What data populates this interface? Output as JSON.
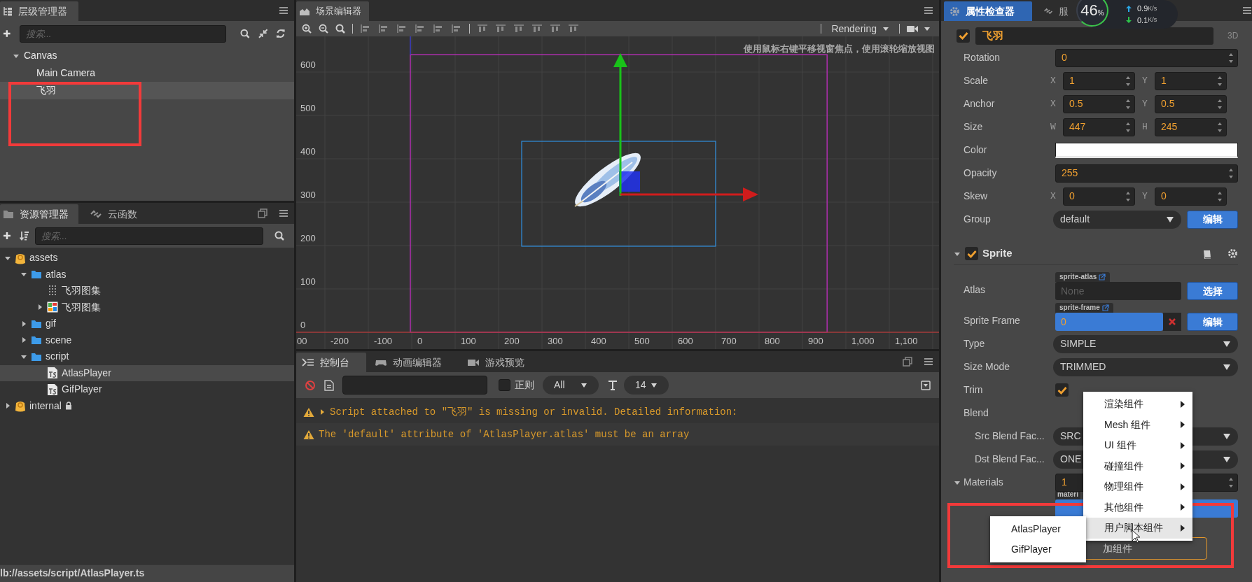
{
  "hierarchy": {
    "title": "层级管理器",
    "search": {
      "placeholder": "搜索..."
    },
    "tree": [
      {
        "label": "Canvas",
        "expanded": true,
        "selected": false,
        "children": [
          {
            "label": "Main Camera",
            "selected": false
          },
          {
            "label": "飞羽",
            "selected": true
          }
        ]
      }
    ]
  },
  "assets": {
    "tabs": [
      {
        "label": "资源管理器",
        "selected": true
      },
      {
        "label": "云函数",
        "selected": false
      }
    ],
    "search": {
      "placeholder": "搜索..."
    },
    "tree": [
      {
        "label": "assets",
        "kind": "db",
        "expanded": true,
        "selected": false,
        "children": [
          {
            "label": "atlas",
            "kind": "folder",
            "expanded": true,
            "selected": false,
            "children": [
              {
                "label": "飞羽图集",
                "kind": "plist",
                "selected": false
              },
              {
                "label": "飞羽图集",
                "kind": "texture",
                "expanded": false,
                "selected": false
              }
            ]
          },
          {
            "label": "gif",
            "kind": "folder",
            "expanded": false,
            "selected": false
          },
          {
            "label": "scene",
            "kind": "folder",
            "expanded": false,
            "selected": false
          },
          {
            "label": "script",
            "kind": "folder",
            "expanded": true,
            "selected": false,
            "children": [
              {
                "label": "AtlasPlayer",
                "kind": "ts",
                "selected": true
              },
              {
                "label": "GifPlayer",
                "kind": "ts",
                "selected": false
              }
            ]
          }
        ]
      },
      {
        "label": "internal",
        "kind": "db",
        "expanded": false,
        "selected": false,
        "locked": true
      }
    ]
  },
  "status_bar": "lb://assets/script/AtlasPlayer.ts",
  "scene": {
    "title": "场景编辑器",
    "render_mode": "Rendering",
    "hint": "使用鼠标右键平移视窗焦点，使用滚轮缩放视图",
    "y_ruler": [
      "600",
      "500",
      "400",
      "300",
      "200",
      "100",
      "0"
    ],
    "x_ruler": [
      "00",
      "-200",
      "-100",
      "0",
      "100",
      "200",
      "300",
      "400",
      "500",
      "600",
      "700",
      "800",
      "900",
      "1,000",
      "1,100"
    ]
  },
  "console": {
    "tabs": [
      {
        "label": "控制台",
        "selected": true
      },
      {
        "label": "动画编辑器",
        "selected": false
      },
      {
        "label": "游戏预览",
        "selected": false
      }
    ],
    "regex": {
      "label": "正则",
      "checked": false
    },
    "level_filter": "All",
    "font_size": "14",
    "logs": [
      {
        "kind": "warning",
        "expandable": true,
        "text": "Script attached to \"飞羽\" is missing or invalid. Detailed information:"
      },
      {
        "kind": "warning",
        "expandable": false,
        "text": "The 'default' attribute of 'AtlasPlayer.atlas' must be an array"
      }
    ]
  },
  "inspector": {
    "tabs": [
      {
        "label": "属性检查器",
        "selected": true
      },
      {
        "label": "服",
        "selected": false
      }
    ],
    "node": {
      "enabled": true,
      "name": "飞羽",
      "mode": "3D"
    },
    "properties": [
      {
        "kind": "number",
        "label": "Rotation",
        "value": "0"
      },
      {
        "kind": "pair",
        "label": "Scale",
        "fields": [
          {
            "axis": "X",
            "value": "1"
          },
          {
            "axis": "Y",
            "value": "1"
          }
        ]
      },
      {
        "kind": "pair",
        "label": "Anchor",
        "fields": [
          {
            "axis": "X",
            "value": "0.5"
          },
          {
            "axis": "Y",
            "value": "0.5"
          }
        ]
      },
      {
        "kind": "pair",
        "label": "Size",
        "fields": [
          {
            "axis": "W",
            "value": "447"
          },
          {
            "axis": "H",
            "value": "245"
          }
        ]
      },
      {
        "kind": "color",
        "label": "Color",
        "color": "#ffffff"
      },
      {
        "kind": "number",
        "label": "Opacity",
        "value": "255"
      },
      {
        "kind": "pair",
        "label": "Skew",
        "fields": [
          {
            "axis": "X",
            "value": "0"
          },
          {
            "axis": "Y",
            "value": "0"
          }
        ]
      },
      {
        "kind": "select",
        "label": "Group",
        "value": "default",
        "button": "编辑"
      }
    ],
    "component": {
      "name": "Sprite",
      "enabled": true,
      "expanded": true,
      "properties": [
        {
          "kind": "asset",
          "label": "Atlas",
          "tag": "sprite-atlas",
          "placeholder": "None",
          "button": "选择"
        },
        {
          "kind": "asset",
          "label": "Sprite Frame",
          "tag": "sprite-frame",
          "value": "0",
          "button": "编辑"
        },
        {
          "kind": "select",
          "label": "Type",
          "value": "SIMPLE"
        },
        {
          "kind": "select",
          "label": "Size Mode",
          "value": "TRIMMED"
        },
        {
          "kind": "check",
          "label": "Trim",
          "checked": true
        },
        {
          "kind": "heading",
          "label": "Blend"
        },
        {
          "kind": "select",
          "label": "Src Blend Fac...",
          "value": "SRC",
          "sub": true
        },
        {
          "kind": "select",
          "label": "Dst Blend Fac...",
          "value": "ONE",
          "sub": true
        },
        {
          "kind": "number",
          "label": "Materials",
          "value": "1",
          "expanded": true
        },
        {
          "kind": "material",
          "tag": "materi"
        }
      ]
    },
    "add_component": "加组件"
  },
  "network_widget": {
    "percent": "46",
    "unit": "%",
    "up": "0.9",
    "up_unit": "K/s",
    "down": "0.1",
    "down_unit": "K/s"
  },
  "context_menu": {
    "items": [
      {
        "label": "渲染组件",
        "selected": false
      },
      {
        "label": "Mesh 组件",
        "selected": false
      },
      {
        "label": "UI 组件",
        "selected": false
      },
      {
        "label": "碰撞组件",
        "selected": false
      },
      {
        "label": "物理组件",
        "selected": false
      },
      {
        "label": "其他组件",
        "selected": false
      },
      {
        "label": "用户脚本组件",
        "selected": true
      }
    ],
    "submenu": [
      {
        "label": "AtlasPlayer"
      },
      {
        "label": "GifPlayer"
      }
    ]
  }
}
